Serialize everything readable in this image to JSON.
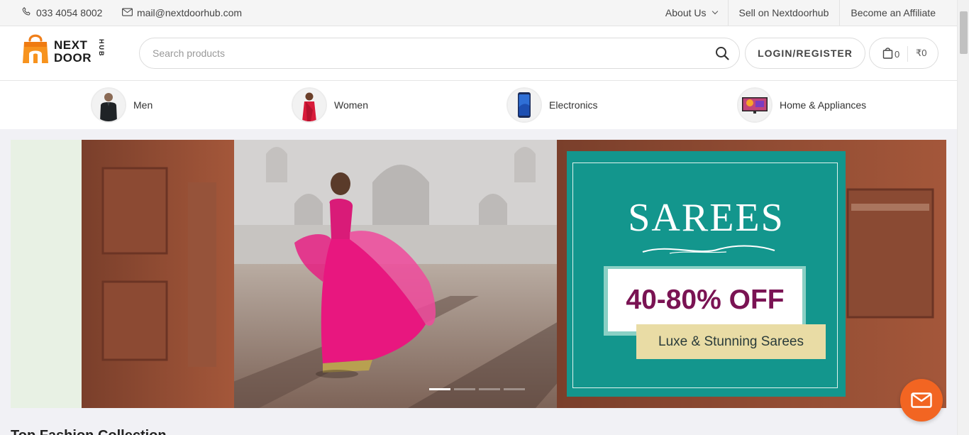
{
  "topbar": {
    "phone": "033 4054 8002",
    "email": "mail@nextdoorhub.com",
    "links": [
      {
        "label": "About Us",
        "has_dropdown": true
      },
      {
        "label": "Sell on Nextdoorhub",
        "has_dropdown": false
      },
      {
        "label": "Become an Affiliate",
        "has_dropdown": false
      }
    ]
  },
  "header": {
    "logo": {
      "line1": "NEXT",
      "line2": "DOOR",
      "side": "HUB"
    },
    "search_placeholder": "Search products",
    "login_label": "LOGIN/REGISTER",
    "cart_count": "0",
    "cart_total": "₹0"
  },
  "categories": [
    {
      "label": "Men",
      "icon": "men-thumbnail"
    },
    {
      "label": "Women",
      "icon": "women-thumbnail"
    },
    {
      "label": "Electronics",
      "icon": "smartphone-thumbnail"
    },
    {
      "label": "Home & Appliances",
      "icon": "tv-thumbnail"
    }
  ],
  "banner": {
    "title": "SAREES",
    "offer": "40-80% OFF",
    "subtitle": "Luxe & Stunning Sarees",
    "slides": 4,
    "active_slide": 1
  },
  "section": {
    "title": "Top Fashion Collection"
  },
  "colors": {
    "accent": "#f26522",
    "promo_teal": "#13968d",
    "offer_text": "#7a1353",
    "subtitle_bg": "#e9dca5"
  }
}
